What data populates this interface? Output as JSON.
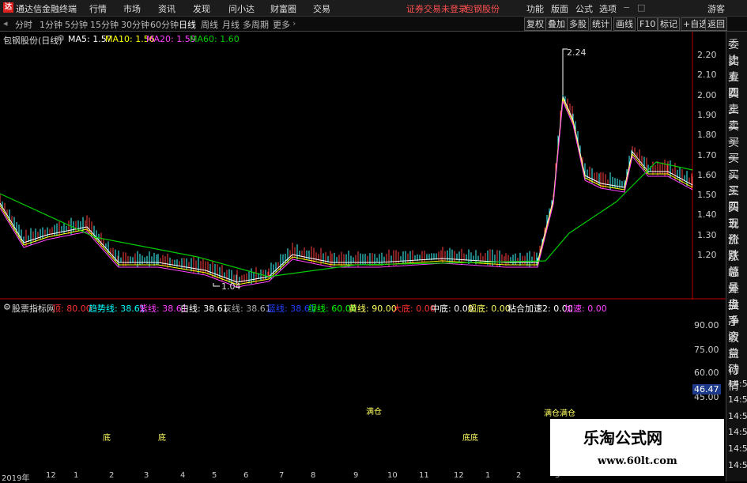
{
  "titlebar": {
    "app_name": "通达信金融终端",
    "menus": [
      "行情",
      "市场",
      "资讯",
      "发现",
      "问小达",
      "财富圈",
      "交易"
    ],
    "notice": "证券交易未登录",
    "stock_name": "包钢股份",
    "right_menus": [
      "功能",
      "版面",
      "公式",
      "选项"
    ],
    "guest": "游客"
  },
  "period_bar": {
    "periods": [
      "分时",
      "1分钟",
      "5分钟",
      "15分钟",
      "30分钟",
      "60分钟",
      "日线",
      "周线",
      "月线",
      "多周期",
      "更多"
    ],
    "active": "日线",
    "tools": [
      "复权",
      "叠加",
      "多股",
      "统计",
      "画线",
      "F10",
      "标记",
      "+自选",
      "返回"
    ]
  },
  "price_chart": {
    "title": "包钢股份(日线)",
    "ma": [
      {
        "label": "MA5: 1.57",
        "color": "#ffffff"
      },
      {
        "label": "MA10: 1.56",
        "color": "#ffff00"
      },
      {
        "label": "MA20: 1.59",
        "color": "#ff40ff"
      },
      {
        "label": "MA60: 1.60",
        "color": "#00cc00"
      }
    ],
    "high_label": "2.24",
    "low_label": "1.04",
    "y_ticks": [
      "2.20",
      "2.10",
      "2.00",
      "1.90",
      "1.80",
      "1.70",
      "1.60",
      "1.50",
      "1.40",
      "1.30",
      "1.20"
    ]
  },
  "indicator": {
    "title": "股票指标网",
    "params": [
      {
        "label": "顶: 80.00",
        "color": "#ff3030"
      },
      {
        "label": "趋势线: 38.61",
        "color": "#00ffff"
      },
      {
        "label": "紫线: 38.61",
        "color": "#ff40ff"
      },
      {
        "label": "白线: 38.61",
        "color": "#ffffff"
      },
      {
        "label": "灰线: 38.61",
        "color": "#aaaaaa"
      },
      {
        "label": "蓝线: 38.61",
        "color": "#2040ff"
      },
      {
        "label": "绿线: 60.00",
        "color": "#00ff00"
      },
      {
        "label": "黄线: 90.00",
        "color": "#ffff60"
      },
      {
        "label": "大底: 0.00",
        "color": "#ff3030"
      },
      {
        "label": "中底: 0.00",
        "color": "#ffffff"
      },
      {
        "label": "超底: 0.00",
        "color": "#ffff60"
      },
      {
        "label": "粘合加速2: 0.00",
        "color": "#ffffff"
      },
      {
        "label": "加速: 0.00",
        "color": "#ff40ff"
      }
    ],
    "y_ticks": [
      "90.00",
      "75.00",
      "60.00",
      "45.00"
    ],
    "current_value": "46.47",
    "signal_labels": [
      "满仓",
      "满仓满仓",
      "底底",
      "底",
      "底",
      "底底",
      "底",
      "底",
      "满仓满仓"
    ]
  },
  "x_axis": {
    "labels": [
      "2019年",
      "12",
      "1",
      "2",
      "3",
      "4",
      "5",
      "6",
      "7",
      "8",
      "9",
      "10",
      "11",
      "12",
      "1",
      "2",
      "3"
    ]
  },
  "right_panel": {
    "items": [
      "委比",
      "卖五",
      "卖四",
      "卖三",
      "卖二",
      "卖一",
      "买一",
      "买二",
      "买三",
      "买四",
      "买五",
      "现价",
      "涨跌",
      "涨幅",
      "总量",
      "外盘",
      "换手",
      "净资",
      "收益",
      "自动",
      "行情",
      "14:50",
      "14:50",
      "14:50",
      "14:50",
      "14:50",
      "14:50"
    ]
  },
  "watermark": {
    "line1": "乐淘公式网",
    "line2": "www.60lt.com"
  }
}
